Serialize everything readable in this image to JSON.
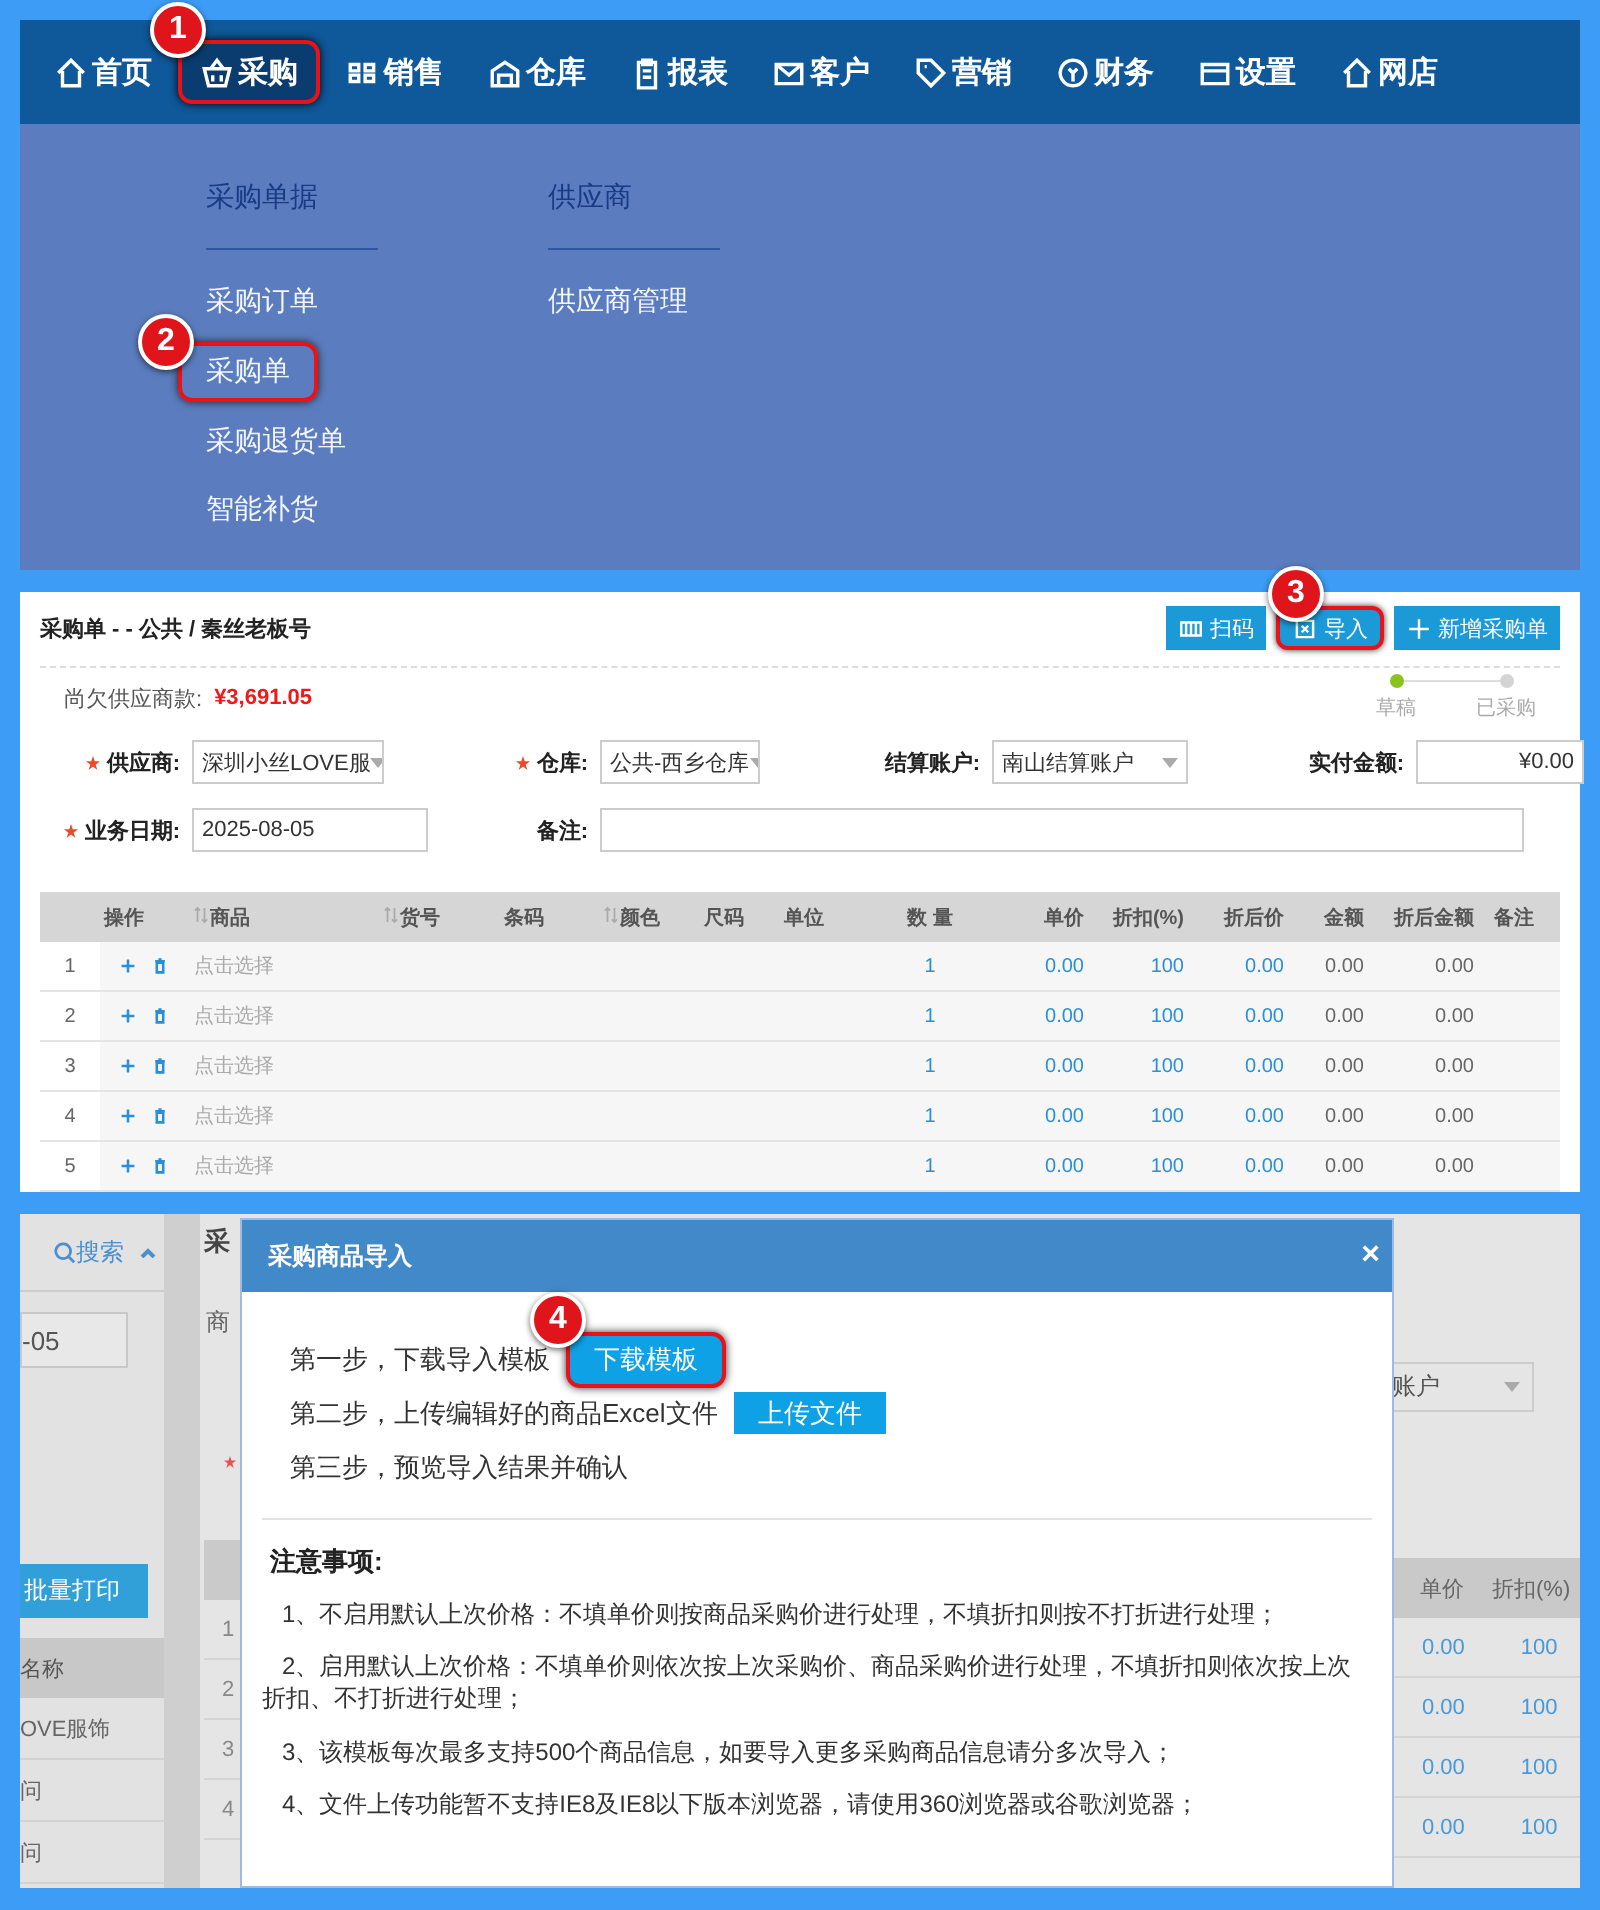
{
  "menu_panel": {
    "nav": [
      {
        "label": "首页",
        "selected": false
      },
      {
        "label": "采购",
        "selected": true,
        "callout": "1"
      },
      {
        "label": "销售",
        "selected": false
      },
      {
        "label": "仓库",
        "selected": false
      },
      {
        "label": "报表",
        "selected": false
      },
      {
        "label": "客户",
        "selected": false
      },
      {
        "label": "营销",
        "selected": false
      },
      {
        "label": "财务",
        "selected": false
      },
      {
        "label": "设置",
        "selected": false
      },
      {
        "label": "网店",
        "selected": false
      }
    ],
    "menu_columns": [
      {
        "heading": "采购单据",
        "items": [
          {
            "label": "采购订单"
          },
          {
            "label": "采购单",
            "callout": "2"
          },
          {
            "label": "采购退货单"
          },
          {
            "label": "智能补货"
          }
        ]
      },
      {
        "heading": "供应商",
        "items": [
          {
            "label": "供应商管理"
          }
        ]
      }
    ]
  },
  "order_panel": {
    "title": "采购单 - - 公共 / 秦丝老板号",
    "toolbar": [
      {
        "label": "扫码"
      },
      {
        "label": "导入",
        "callout": "3"
      },
      {
        "label": "新增采购单"
      }
    ],
    "steps": [
      {
        "label": "草稿",
        "done": true
      },
      {
        "label": "已采购",
        "done": false
      }
    ],
    "debt": {
      "label": "尚欠供应商款:",
      "value": "¥3,691.05"
    },
    "form_rows": [
      [
        {
          "label": "供应商:",
          "required": true,
          "kind": "select",
          "value": "深圳小丝LOVE服"
        },
        {
          "label": "仓库:",
          "required": true,
          "kind": "select",
          "value": "公共-西乡仓库"
        },
        {
          "label": "结算账户:",
          "required": false,
          "kind": "select",
          "value": "南山结算账户"
        },
        {
          "label": "实付金额:",
          "required": false,
          "kind": "amount",
          "value": "¥0.00"
        }
      ],
      [
        {
          "label": "业务日期:",
          "required": true,
          "kind": "input",
          "value": "2025-08-05"
        },
        {
          "label": "备注:",
          "required": false,
          "kind": "wide"
        }
      ]
    ],
    "table": {
      "columns": [
        {
          "label": "操作",
          "sortable": false
        },
        {
          "label": "商品",
          "sortable": true
        },
        {
          "label": "货号",
          "sortable": true
        },
        {
          "label": "条码",
          "sortable": false
        },
        {
          "label": "颜色",
          "sortable": true
        },
        {
          "label": "尺码",
          "sortable": false
        },
        {
          "label": "单位",
          "sortable": false
        },
        {
          "label": "数 量",
          "sortable": false
        },
        {
          "label": "单价",
          "sortable": false
        },
        {
          "label": "折扣(%)",
          "sortable": false
        },
        {
          "label": "折后价",
          "sortable": false
        },
        {
          "label": "金额",
          "sortable": false
        },
        {
          "label": "折后金额",
          "sortable": false
        },
        {
          "label": "备注",
          "sortable": false
        }
      ],
      "rows": [
        {
          "no": "1",
          "product": "点击选择",
          "quantity": "1",
          "unit_price": "0.00",
          "discount": "100",
          "discounted_price": "0.00",
          "amount": "0.00",
          "discounted_amount": "0.00"
        },
        {
          "no": "2",
          "product": "点击选择",
          "quantity": "1",
          "unit_price": "0.00",
          "discount": "100",
          "discounted_price": "0.00",
          "amount": "0.00",
          "discounted_amount": "0.00"
        },
        {
          "no": "3",
          "product": "点击选择",
          "quantity": "1",
          "unit_price": "0.00",
          "discount": "100",
          "discounted_price": "0.00",
          "amount": "0.00",
          "discounted_amount": "0.00"
        },
        {
          "no": "4",
          "product": "点击选择",
          "quantity": "1",
          "unit_price": "0.00",
          "discount": "100",
          "discounted_price": "0.00",
          "amount": "0.00",
          "discounted_amount": "0.00"
        },
        {
          "no": "5",
          "product": "点击选择",
          "quantity": "1",
          "unit_price": "0.00",
          "discount": "100",
          "discounted_price": "0.00",
          "amount": "0.00",
          "discounted_amount": "0.00"
        }
      ]
    }
  },
  "import_panel": {
    "background": {
      "search": "搜索",
      "date_fragment": "-05",
      "print_button": "批量打印",
      "list_header": "名称",
      "list_rows": [
        "OVE服饰",
        "问",
        "问"
      ],
      "title_fragment": "采",
      "label_fragment": "商",
      "row_numbers": [
        "1",
        "2",
        "3",
        "4"
      ],
      "account_fragment": "账户",
      "columns": [
        "单价",
        "折扣(%)"
      ],
      "rows": [
        [
          "0.00",
          "100"
        ],
        [
          "0.00",
          "100"
        ],
        [
          "0.00",
          "100"
        ],
        [
          "0.00",
          "100"
        ]
      ]
    },
    "dialog": {
      "title": "采购商品导入",
      "close": "×",
      "steps": [
        {
          "text": "第一步，下载导入模板",
          "button": "下载模板",
          "callout": "4"
        },
        {
          "text": "第二步，上传编辑好的商品Excel文件",
          "button": "上传文件"
        },
        {
          "text": "第三步，预览导入结果并确认"
        }
      ],
      "notes_heading": "注意事项:",
      "notes": [
        "1、不启用默认上次价格：不填单价则按商品采购价进行处理，不填折扣则按不打折进行处理；",
        "2、启用默认上次价格：不填单价则依次按上次采购价、商品采购价进行处理，不填折扣则依次按上次折扣、不打折进行处理；",
        "3、该模板每次最多支持500个商品信息，如要导入更多采购商品信息请分多次导入；",
        "4、文件上传功能暂不支持IE8及IE8以下版本浏览器，请使用360浏览器或谷歌浏览器；"
      ]
    }
  }
}
